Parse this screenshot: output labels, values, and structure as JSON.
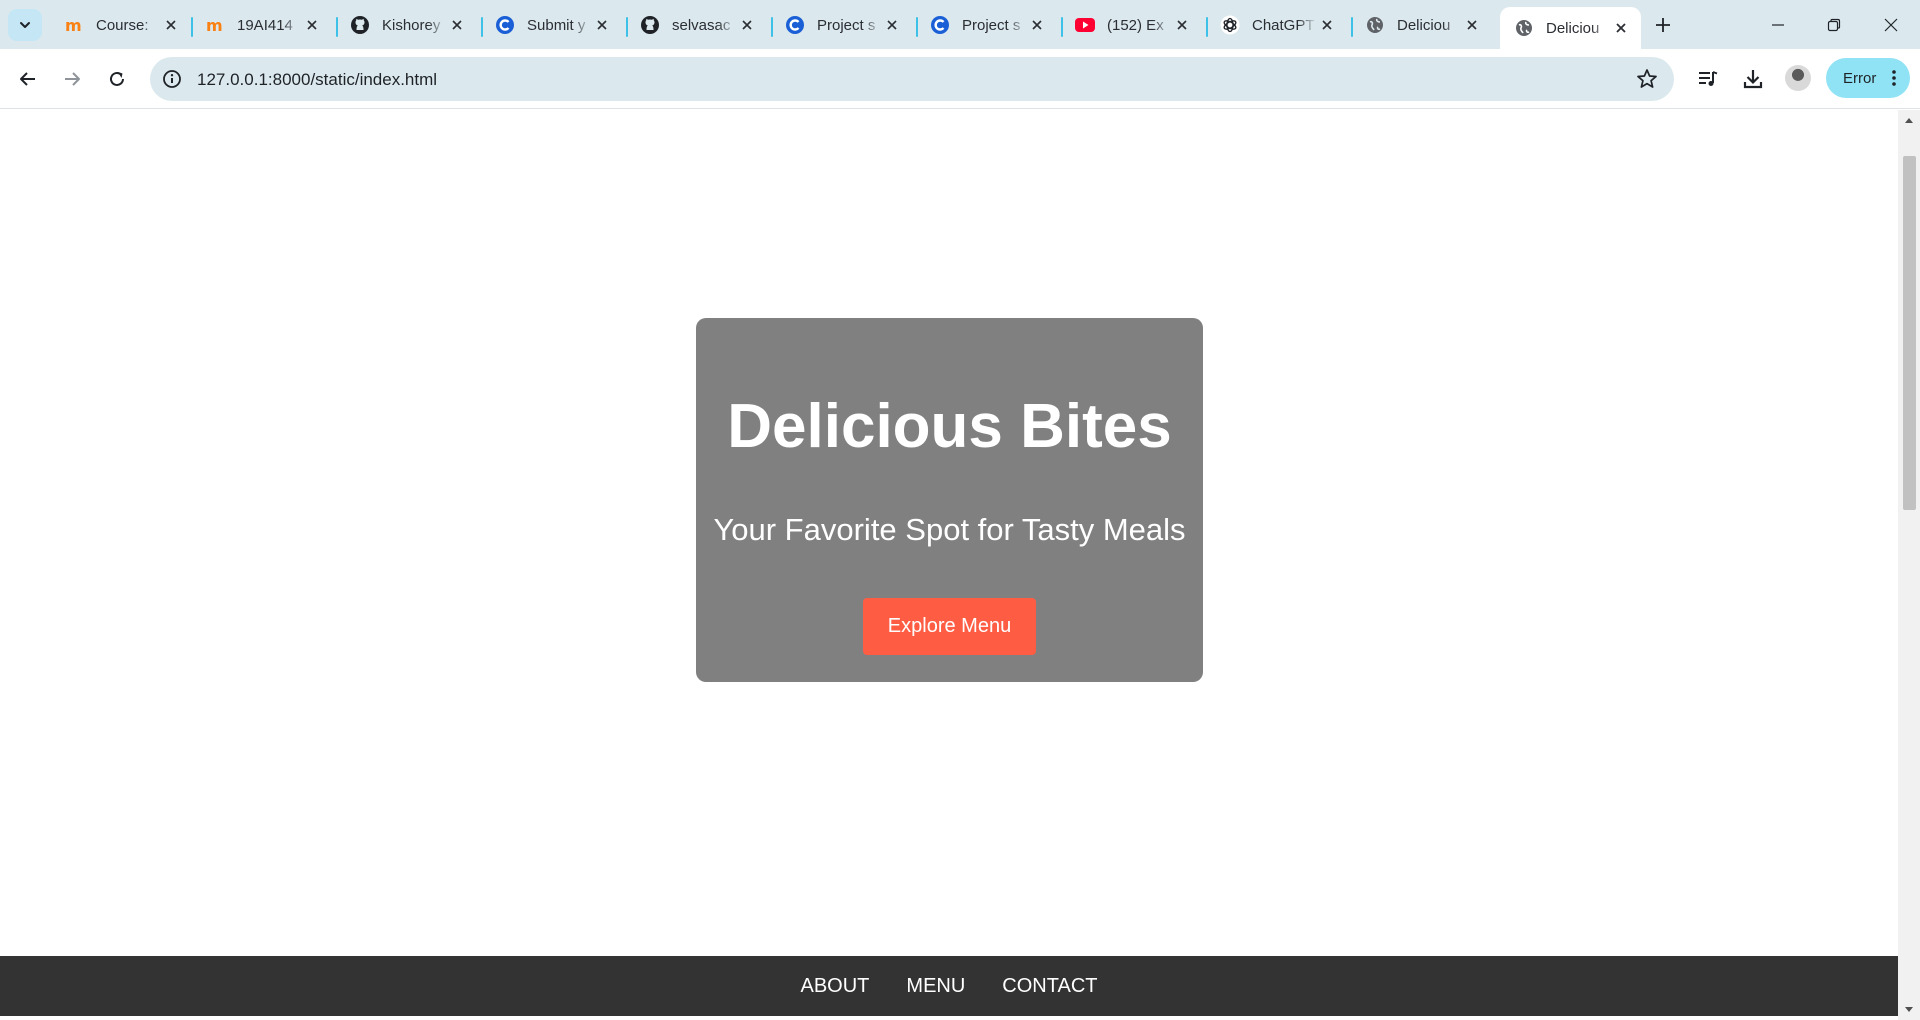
{
  "browser": {
    "tabs": [
      {
        "title": "Course:",
        "icon": "moodle-icon"
      },
      {
        "title": "19AI414",
        "icon": "moodle-icon"
      },
      {
        "title": "Kishorey",
        "icon": "github-icon"
      },
      {
        "title": "Submit y",
        "icon": "c-circle-icon"
      },
      {
        "title": "selvasac",
        "icon": "github-icon"
      },
      {
        "title": "Project s",
        "icon": "c-circle-icon"
      },
      {
        "title": "Project s",
        "icon": "c-circle-icon"
      },
      {
        "title": "(152) Ex",
        "icon": "youtube-icon"
      },
      {
        "title": "ChatGPT",
        "icon": "chatgpt-icon"
      },
      {
        "title": "Deliciou",
        "icon": "globe-icon"
      },
      {
        "title": "Deliciou",
        "icon": "globe-icon",
        "active": true
      }
    ],
    "url": "127.0.0.1:8000/static/index.html",
    "error_label": "Error",
    "colors": {
      "tabstrip": "#dbe9ee",
      "tab_separator": "#3ec1e8",
      "error_pill": "#8fe3f5"
    }
  },
  "page": {
    "hero": {
      "title": "Delicious Bites",
      "subtitle": "Your Favorite Spot for Tasty Meals",
      "cta_label": "Explore Menu"
    },
    "footer": {
      "links": [
        "ABOUT",
        "MENU",
        "CONTACT"
      ]
    },
    "colors": {
      "hero_bg": "#808080",
      "cta_bg": "#ff5c44",
      "footer_bg": "#333333"
    }
  }
}
